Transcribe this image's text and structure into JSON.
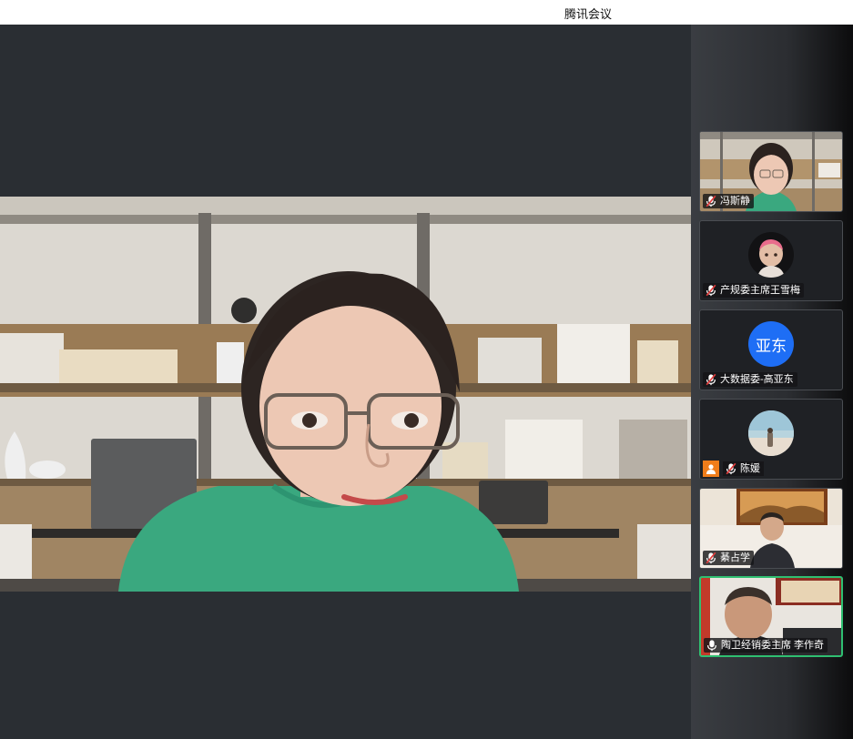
{
  "window": {
    "title": "腾讯会议"
  },
  "main_speaker": {
    "name": "冯斯静"
  },
  "participants": [
    {
      "name": "冯斯静",
      "view": "video",
      "mic": "muted"
    },
    {
      "name": "产规委主席王雪梅",
      "view": "avatar-photo",
      "mic": "muted"
    },
    {
      "name": "大数据委-高亚东",
      "view": "avatar-text",
      "avatar_text": "亚东",
      "mic": "muted"
    },
    {
      "name": "陈媛",
      "view": "avatar-photo",
      "mic": "muted",
      "host": true
    },
    {
      "name": "綦占学",
      "view": "video",
      "mic": "muted"
    },
    {
      "name": "陶卫经销委主席 李作奇",
      "view": "video",
      "mic": "on",
      "active_speaker": true
    }
  ],
  "colors": {
    "active_border": "#2fbf71",
    "avatar_blue": "#1e6ef5",
    "host_badge": "#f07d1a",
    "stage_bg": "#2a2e33"
  }
}
